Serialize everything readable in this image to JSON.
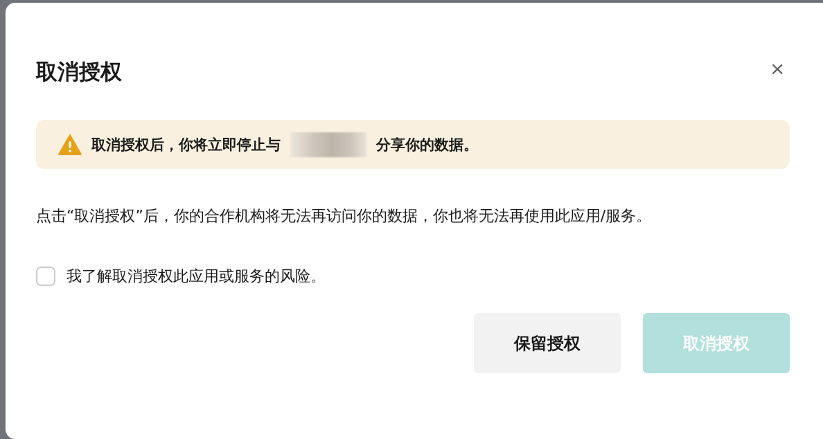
{
  "dialog": {
    "title": "取消授权",
    "close": "×"
  },
  "warning": {
    "before": "取消授权后，你将立即停止与",
    "redacted": true,
    "after": "分享你的数据。"
  },
  "message": "点击“取消授权”后，你的合作机构将无法再访问你的数据，你也将无法再使用此应用/服务。",
  "consent": {
    "label": "我了解取消授权此应用或服务的风险。",
    "checked": false
  },
  "buttons": [
    {
      "label": "保留授权",
      "kind": "secondary",
      "disabled": false
    },
    {
      "label": "取消授权",
      "kind": "primary",
      "disabled": true
    }
  ]
}
